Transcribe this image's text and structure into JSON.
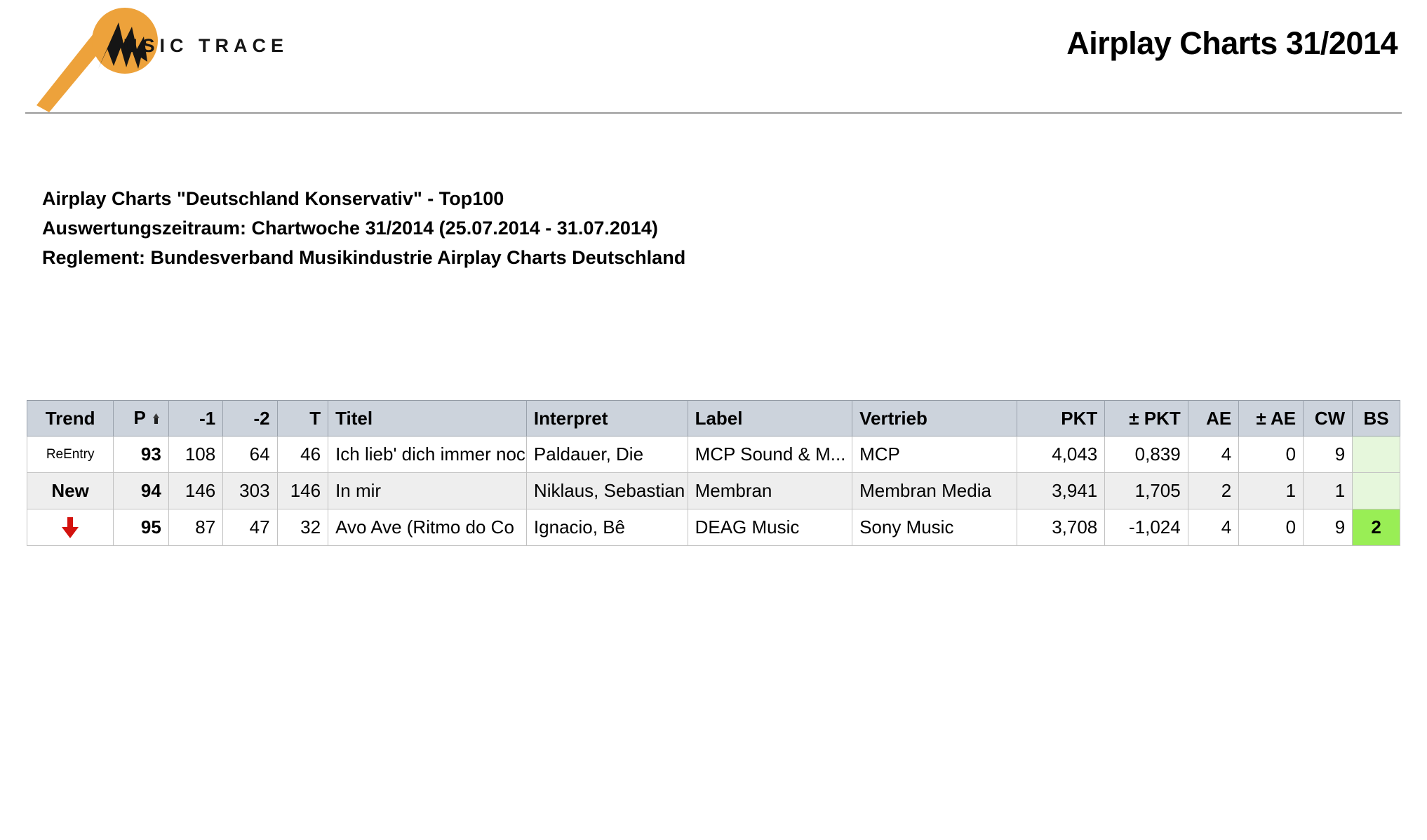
{
  "header": {
    "logo_text": "MUSIC TRACE",
    "logo_color": "#eda23b",
    "title": "Airplay Charts 31/2014"
  },
  "description": {
    "line1": "Airplay Charts \"Deutschland Konservativ\" - Top100",
    "line2": "Auswertungszeitraum:  Chartwoche 31/2014 (25.07.2014 - 31.07.2014)",
    "line3": "Reglement: Bundesverband Musikindustrie Airplay Charts Deutschland"
  },
  "table": {
    "columns": [
      {
        "key": "trend",
        "label": "Trend"
      },
      {
        "key": "p",
        "label": "P",
        "sorted": true,
        "sort_icon": "sort-ascending-icon"
      },
      {
        "key": "m1",
        "label": "-1"
      },
      {
        "key": "m2",
        "label": "-2"
      },
      {
        "key": "t",
        "label": "T"
      },
      {
        "key": "titel",
        "label": "Titel"
      },
      {
        "key": "interpret",
        "label": "Interpret"
      },
      {
        "key": "label",
        "label": "Label"
      },
      {
        "key": "vertrieb",
        "label": "Vertrieb"
      },
      {
        "key": "pkt",
        "label": "PKT"
      },
      {
        "key": "dpkt",
        "label": "± PKT"
      },
      {
        "key": "ae",
        "label": "AE"
      },
      {
        "key": "dae",
        "label": "± AE"
      },
      {
        "key": "cw",
        "label": "CW"
      },
      {
        "key": "bs",
        "label": "BS"
      }
    ],
    "rows": [
      {
        "trend": "ReEntry",
        "trend_type": "reentry",
        "p": "93",
        "m1": "108",
        "m2": "64",
        "t": "46",
        "titel": "Ich lieb' dich immer noch",
        "interpret": "Paldauer, Die",
        "label": "MCP Sound & M...",
        "vertrieb": "MCP",
        "pkt": "4,043",
        "dpkt": "0,839",
        "ae": "4",
        "dae": "0",
        "cw": "9",
        "bs": "",
        "bs_highlight": false
      },
      {
        "trend": "New",
        "trend_type": "new",
        "p": "94",
        "m1": "146",
        "m2": "303",
        "t": "146",
        "titel": "In mir",
        "interpret": "Niklaus, Sebastian",
        "label": "Membran",
        "vertrieb": "Membran Media",
        "pkt": "3,941",
        "dpkt": "1,705",
        "ae": "2",
        "dae": "1",
        "cw": "1",
        "bs": "",
        "bs_highlight": false
      },
      {
        "trend": "",
        "trend_type": "down-arrow",
        "trend_color": "#d3120e",
        "p": "95",
        "m1": "87",
        "m2": "47",
        "t": "32",
        "titel": "Avo Ave (Ritmo do Co",
        "interpret": "Ignacio, Bê",
        "label": "DEAG Music",
        "vertrieb": "Sony Music",
        "pkt": "3,708",
        "dpkt": "-1,024",
        "ae": "4",
        "dae": "0",
        "cw": "9",
        "bs": "2",
        "bs_highlight": true
      }
    ]
  },
  "colors": {
    "header_bg": "#ccd3dc",
    "row_alt_bg": "#eeeeee",
    "bs_pale_green": "#e6f7dc",
    "bs_bright_green": "#99ee55",
    "trend_down_red": "#d3120e",
    "rule": "#9a9a9a"
  }
}
